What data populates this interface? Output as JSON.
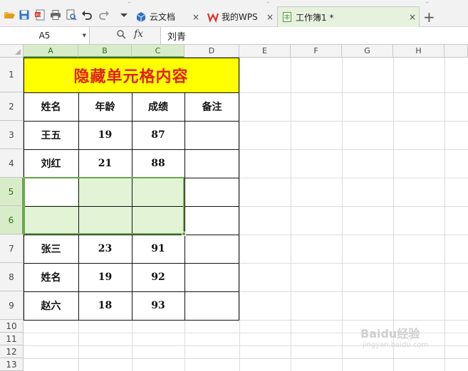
{
  "tabs": [
    {
      "label": "云文档"
    },
    {
      "label": "我的WPS"
    },
    {
      "label": "工作簿1 *"
    }
  ],
  "tab_close": "×",
  "new_tab": "+",
  "formula_bar": {
    "cell_ref": "A5",
    "fx_label": "fx",
    "content": "刘青"
  },
  "columns": [
    "A",
    "B",
    "C",
    "D",
    "E",
    "F",
    "G",
    "H"
  ],
  "rows": [
    "1",
    "2",
    "3",
    "4",
    "5",
    "6",
    "7",
    "8",
    "9",
    "10",
    "11",
    "12",
    "13"
  ],
  "sheet": {
    "title": "隐藏单元格内容",
    "headers": [
      "姓名",
      "年龄",
      "成绩",
      "备注"
    ],
    "data": [
      [
        "王五",
        "19",
        "87",
        ""
      ],
      [
        "刘红",
        "21",
        "88",
        ""
      ],
      [
        "",
        "",
        "",
        ""
      ],
      [
        "",
        "",
        "",
        ""
      ],
      [
        "张三",
        "23",
        "91",
        ""
      ],
      [
        "姓名",
        "19",
        "92",
        ""
      ],
      [
        "赵六",
        "18",
        "93",
        ""
      ]
    ]
  },
  "selection": {
    "range": "A5:C6",
    "active": "A5"
  },
  "watermark": {
    "text": "Baidu经验",
    "sub": "jingyan.baidu.com"
  },
  "colors": {
    "title_bg": "#ffff00",
    "title_text": "#e0211b",
    "selection": "#6aa84f",
    "selection_fill": "#e2f3d6"
  }
}
